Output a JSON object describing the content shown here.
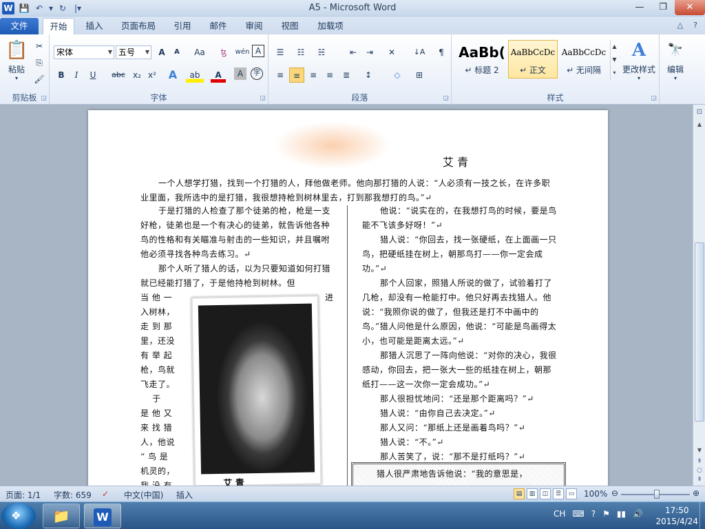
{
  "window": {
    "title": "A5 - Microsoft Word",
    "app_icon": "W"
  },
  "qat": {
    "save": "💾",
    "undo": "↶",
    "undo_drop": "▾",
    "redo": "↻",
    "customize": "|▾"
  },
  "window_buttons": {
    "minimize": "—",
    "restore": "❐",
    "close": "✕"
  },
  "tabs": [
    {
      "label": "文件"
    },
    {
      "label": "开始"
    },
    {
      "label": "插入"
    },
    {
      "label": "页面布局"
    },
    {
      "label": "引用"
    },
    {
      "label": "邮件"
    },
    {
      "label": "审阅"
    },
    {
      "label": "视图"
    },
    {
      "label": "加载项"
    }
  ],
  "tabbar_right": {
    "minimize_ribbon": "△",
    "help": "?"
  },
  "ribbon": {
    "clipboard": {
      "label": "剪贴板",
      "paste": "粘贴",
      "paste_drop": "▾",
      "cut": "✂",
      "copy": "⎘",
      "format_painter": "🖌"
    },
    "font": {
      "label": "字体",
      "font_name": "宋体",
      "font_size": "五号",
      "grow": "A",
      "shrink": "A",
      "case": "Aa",
      "clear": "ꜩ",
      "phonetic": "wén",
      "border_char": "A",
      "bold": "B",
      "italic": "I",
      "underline": "U",
      "strike": "abc",
      "subscript": "x₂",
      "superscript": "x²",
      "effects": "A",
      "highlight": "ab",
      "font_color": "A",
      "shade": "A",
      "enclose": "字"
    },
    "paragraph": {
      "label": "段落",
      "bullets": "☰",
      "numbering": "☷",
      "multilevel": "☵",
      "decrease_indent": "⇤",
      "increase_indent": "⇥",
      "chinese_layout": "✕",
      "sort": "↓A",
      "show_marks": "¶",
      "align_left": "≡",
      "align_center": "≡",
      "align_right": "≡",
      "justify": "≡",
      "distributed": "≣",
      "line_spacing": "↕",
      "shading": "◇",
      "borders": "⊞"
    },
    "styles": {
      "label": "样式",
      "items": [
        {
          "sample": "AaBb(",
          "name": "↵ 标题 2"
        },
        {
          "sample": "AaBbCcDc",
          "name": "↵ 正文"
        },
        {
          "sample": "AaBbCcDc",
          "name": "↵ 无间隔"
        }
      ],
      "change_styles": "更改样式",
      "change_styles_icon": "A"
    },
    "editing": {
      "label": "编辑",
      "icon": "🔭"
    }
  },
  "document": {
    "author": "艾 青",
    "intro": "一个人想学打猎，找到一个打猎的人，拜他做老师。他向那打猎的人说：“人必须有一技之长，在许多职业里面，我所选中的是打猎，我很想持枪到树林里去，打到那我想打的鸟。”↵",
    "left_p1": "于是打猎的人检查了那个徒弟的枪，枪是一支好枪，徒弟也是一个有决心的徒弟，就告诉他各种鸟的性格和有关瞄准与射击的一些知识，并且嘱咐他必须寻找各种鸟去练习。↵",
    "left_p2": "那个人听了猎人的话，以为只要知道如何打猎就已经能打猎了，于是他持枪到树林。但",
    "left_narrow": "当 他 一\n入树林，\n走 到 那\n里，还没\n有 举 起\n枪，鸟就\n飞走了。\n    于\n是 他 又\n来 找 猎\n人，他说\n“ 鸟 是\n机灵的，\n我 没 有",
    "left_narrow_right": "进",
    "photo_caption": "艾 青",
    "right_paragraphs": [
      "他说：“说实在的，在我想打鸟的时候，要是鸟能不飞该多好呀！”↵",
      "猎人说：“你回去，找一张硬纸，在上面画一只鸟，把硬纸挂在树上，朝那鸟打——你一定会成功。”↵",
      "那个人回家，照猎人所说的做了，试验着打了几枪，却没有一枪能打中。他只好再去找猎人。他说：“我照你说的做了，但我还是打不中画中的鸟。”猎人问他是什么原因，他说：“可能是鸟画得太小，也可能是距离太远。”↵",
      "那猎人沉思了一阵向他说：“对你的决心，我很感动，你回去，把一张大一些的纸挂在树上，朝那纸打——这一次你一定会成功。”↵",
      "那人很担忧地问：“还是那个距离吗？”↵",
      "猎人说：“由你自己去决定。”↵",
      "那人又问：“那纸上还是画着鸟吗？”↵",
      "猎人说：“不。”↵",
      "那人苦笑了，说：“那不是打纸吗？”↵"
    ],
    "boxed_text": "猎人很严肃地告诉他说：“我的意思是，"
  },
  "status": {
    "page": "页面: 1/1",
    "words": "字数: 659",
    "proof_icon": "✓",
    "language": "中文(中国)",
    "insert_mode": "插入",
    "zoom": "100%",
    "zoom_minus": "⊖",
    "zoom_plus": "⊕"
  },
  "taskbar": {
    "start_icon": "❖",
    "folder_icon": "📁",
    "word_icon": "W",
    "tray_lang": "CH",
    "tray_icons": [
      "⌨",
      "?",
      "⚑",
      "▮▮",
      "🔊"
    ],
    "time": "17:50",
    "date": "2015/4/24"
  }
}
